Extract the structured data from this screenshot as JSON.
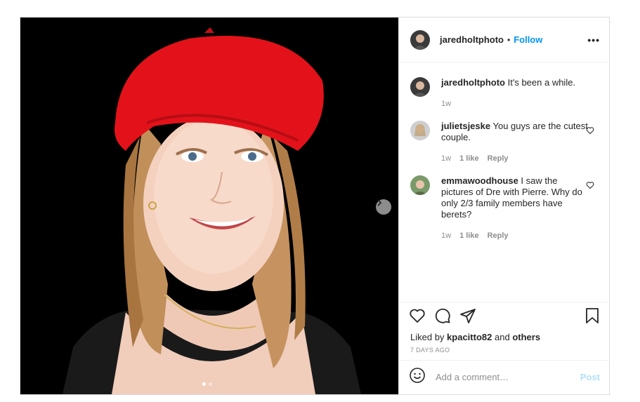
{
  "post": {
    "author": "jaredholtphoto",
    "bullet": "•",
    "follow_label": "Follow",
    "more_label": "•••",
    "caption": "It's been a while.",
    "caption_time": "1w"
  },
  "comments": [
    {
      "user": "julietsjeske",
      "text": "You guys are the cutest couple.",
      "time": "1w",
      "likes": "1 like",
      "reply": "Reply"
    },
    {
      "user": "emmawoodhouse",
      "text": "I saw the pictures of Dre with Pierre. Why do only 2/3 family members have berets?",
      "time": "1w",
      "likes": "1 like",
      "reply": "Reply"
    }
  ],
  "likes": {
    "prefix": "Liked by",
    "user": "kpacitto82",
    "and": "and",
    "others": "others"
  },
  "timestamp": "7 DAYS AGO",
  "add_comment": {
    "placeholder": "Add a comment…",
    "post_label": "Post"
  },
  "carousel": {
    "count": 2,
    "current": 1
  },
  "icons": {
    "like": "heart-icon",
    "comment": "comment-icon",
    "share": "paper-plane-icon",
    "save": "bookmark-icon",
    "emoji": "emoji-icon",
    "next": "chevron-right-icon"
  },
  "colors": {
    "accent": "#0095f6",
    "post_disabled": "#b2dffc",
    "beret": "#e3121a"
  }
}
